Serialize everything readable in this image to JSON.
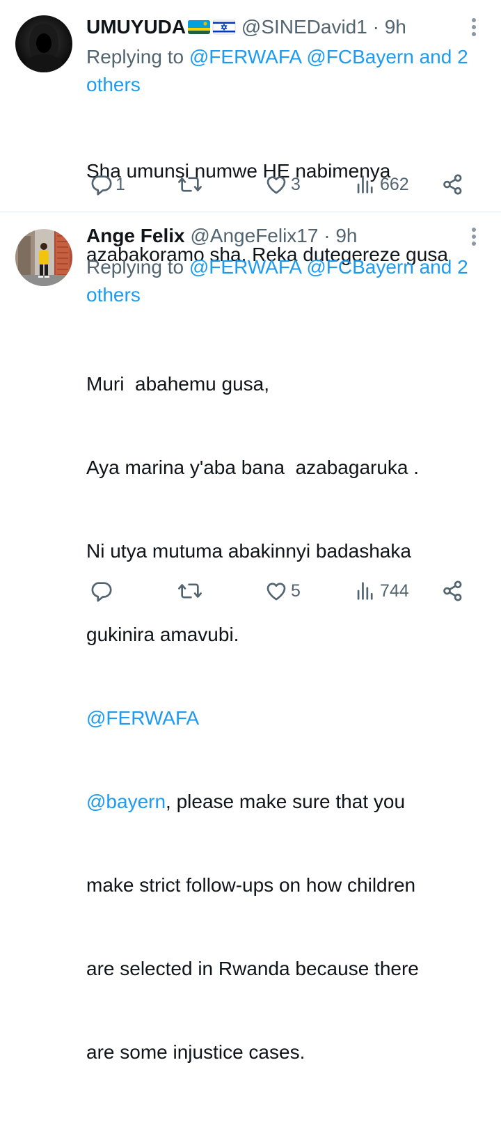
{
  "tweets": [
    {
      "author_name": "UMUYUDA",
      "author_flags": [
        "rwanda-flag",
        "israel-flag"
      ],
      "handle": "@SINEDavid1",
      "separator": "·",
      "time": "9h",
      "replying_prefix": "Replying to ",
      "replying_mentions": "@FERWAFA @FCBayern and 2 others",
      "body_lines": [
        {
          "text": "Sha umunsi numwe HE nabimenya",
          "is_mention": false
        },
        {
          "text": "azabakoramo sha. Reka dutegereze gusa",
          "is_mention": false
        }
      ],
      "stats": {
        "replies": "1",
        "retweets": "",
        "likes": "3",
        "views": "662"
      }
    },
    {
      "author_name": "Ange Felix",
      "author_flags": [],
      "handle": "@AngeFelix17",
      "separator": "·",
      "time": "9h",
      "replying_prefix": "Replying to ",
      "replying_mentions": "@FERWAFA @FCBayern and 2 others",
      "body_lines": [
        {
          "text": "Muri  abahemu gusa,",
          "is_mention": false
        },
        {
          "text": "Aya marina y'aba bana  azabagaruka .",
          "is_mention": false
        },
        {
          "text": "Ni utya mutuma abakinnyi badashaka",
          "is_mention": false
        },
        {
          "text": "gukinira amavubi.",
          "is_mention": false
        },
        {
          "text": "@FERWAFA",
          "is_mention": true
        },
        {
          "text": "@bayern",
          "is_mention": true,
          "suffix": ", please make sure that you"
        },
        {
          "text": "make strict follow-ups on how children",
          "is_mention": false
        },
        {
          "text": "are selected in Rwanda because there",
          "is_mention": false
        },
        {
          "text": "are some injustice cases.",
          "is_mention": false
        }
      ],
      "stats": {
        "replies": "",
        "retweets": "",
        "likes": "5",
        "views": "744"
      }
    }
  ],
  "colors": {
    "link": "#1d9bf0",
    "secondary_text": "#536471",
    "primary_text": "#0f1419",
    "divider": "#e1e8ed"
  }
}
